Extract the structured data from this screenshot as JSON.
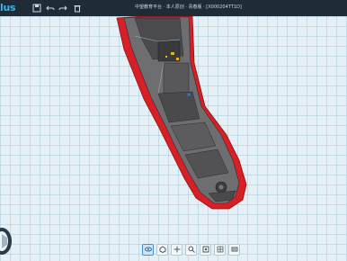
{
  "app": {
    "logo_text": "lus",
    "document_title": "中望教育平台 · 本人原创 · 青春版 · [X000204TT1D]"
  },
  "titlebar_icons": [
    "save-icon",
    "undo-icon",
    "redo-icon",
    "delete-icon"
  ],
  "bottom_toolbar": {
    "buttons": [
      {
        "name": "view-orientation-icon"
      },
      {
        "name": "render-mode-icon"
      },
      {
        "name": "pan-icon"
      },
      {
        "name": "zoom-icon"
      },
      {
        "name": "zoom-fit-icon"
      },
      {
        "name": "grid-toggle-icon"
      },
      {
        "name": "view-settings-icon"
      }
    ]
  },
  "colors": {
    "hull_red": "#d81f26",
    "deck_gray": "#6e6e70",
    "deck_dark": "#3a3a3c",
    "grid": "#a0c3d2",
    "titlebar": "#1f2c38",
    "brand_blue": "#37b7ea"
  }
}
